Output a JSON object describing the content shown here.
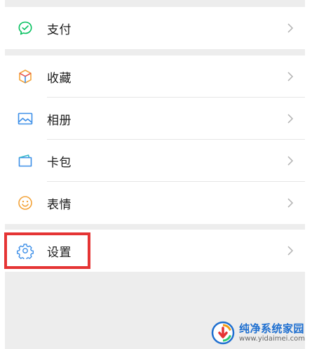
{
  "menu": {
    "pay": {
      "label": "支付",
      "icon": "pay-check-icon"
    },
    "favorites": {
      "label": "收藏",
      "icon": "cube-icon"
    },
    "album": {
      "label": "相册",
      "icon": "image-icon"
    },
    "cards": {
      "label": "卡包",
      "icon": "card-icon"
    },
    "stickers": {
      "label": "表情",
      "icon": "smiley-icon"
    },
    "settings": {
      "label": "设置",
      "icon": "gear-icon"
    }
  },
  "colors": {
    "pay_green": "#07c160",
    "highlight_red": "#e53434",
    "brand_blue": "#1e6fd0",
    "background": "#ededed"
  },
  "watermark": {
    "title": "纯净系统家园",
    "url": "www.yidaimei.com"
  }
}
